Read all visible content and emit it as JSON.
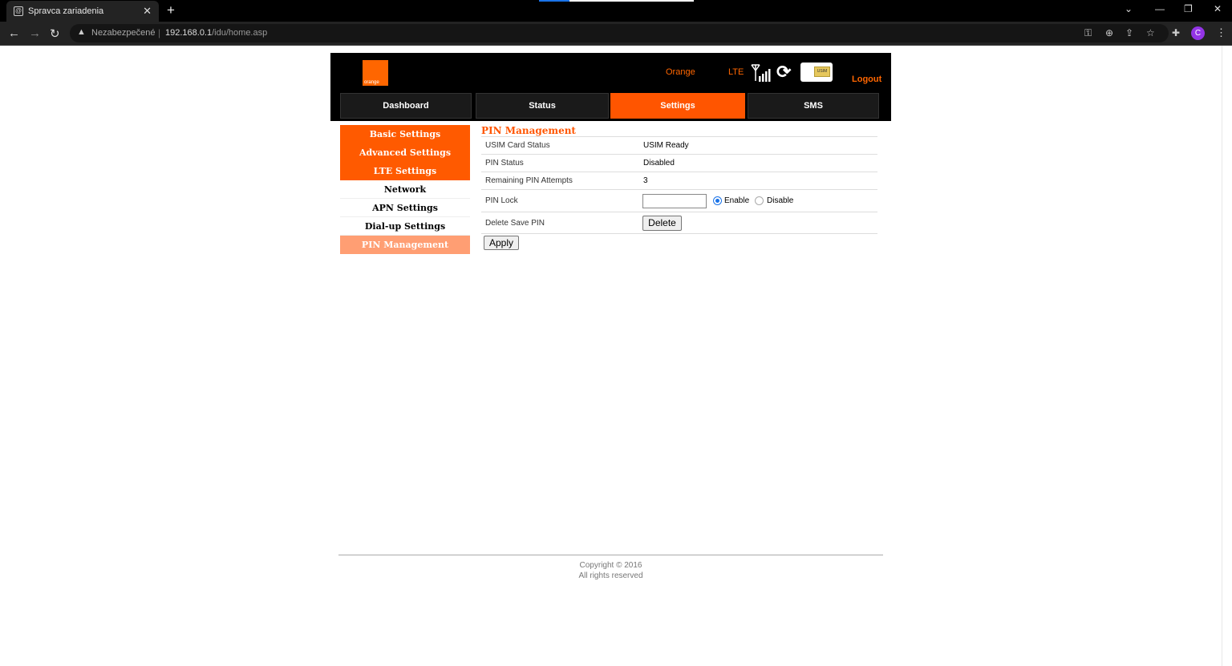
{
  "browser": {
    "tab_title": "Spravca zariadenia",
    "tab_close": "✕",
    "new_tab": "+",
    "security_label": "Nezabezpečené",
    "url_host": "192.168.0.1",
    "url_path": "/idu/home.asp",
    "profile_initial": "C"
  },
  "header": {
    "logo_text": "orange",
    "operator": "Orange",
    "network_type": "LTE",
    "sim_label": "USIM",
    "logout": "Logout"
  },
  "main_nav": [
    {
      "label": "Dashboard"
    },
    {
      "label": "Status"
    },
    {
      "label": "Settings",
      "active": true
    },
    {
      "label": "SMS"
    }
  ],
  "side_menu": [
    {
      "label": "Basic Settings"
    },
    {
      "label": "Advanced Settings"
    },
    {
      "label": "LTE Settings"
    },
    {
      "label": "Network"
    },
    {
      "label": "APN Settings"
    },
    {
      "label": "Dial-up Settings"
    },
    {
      "label": "PIN Management",
      "current": true
    }
  ],
  "pin": {
    "title": "PIN Management",
    "rows": [
      {
        "label": "USIM Card Status",
        "value": "USIM Ready"
      },
      {
        "label": "PIN Status",
        "value": "Disabled"
      },
      {
        "label": "Remaining PIN Attempts",
        "value": "3"
      },
      {
        "label": "PIN Lock"
      },
      {
        "label": "Delete Save PIN"
      }
    ],
    "pin_lock_value": "",
    "enable_label": "Enable",
    "disable_label": "Disable",
    "selected": "Enable",
    "delete_button": "Delete",
    "apply_button": "Apply"
  },
  "footer": {
    "copyright": "Copyright © 2016",
    "rights": "All rights reserved"
  },
  "colors": {
    "accent": "#ff5500",
    "menu_current": "#ff9e73"
  }
}
